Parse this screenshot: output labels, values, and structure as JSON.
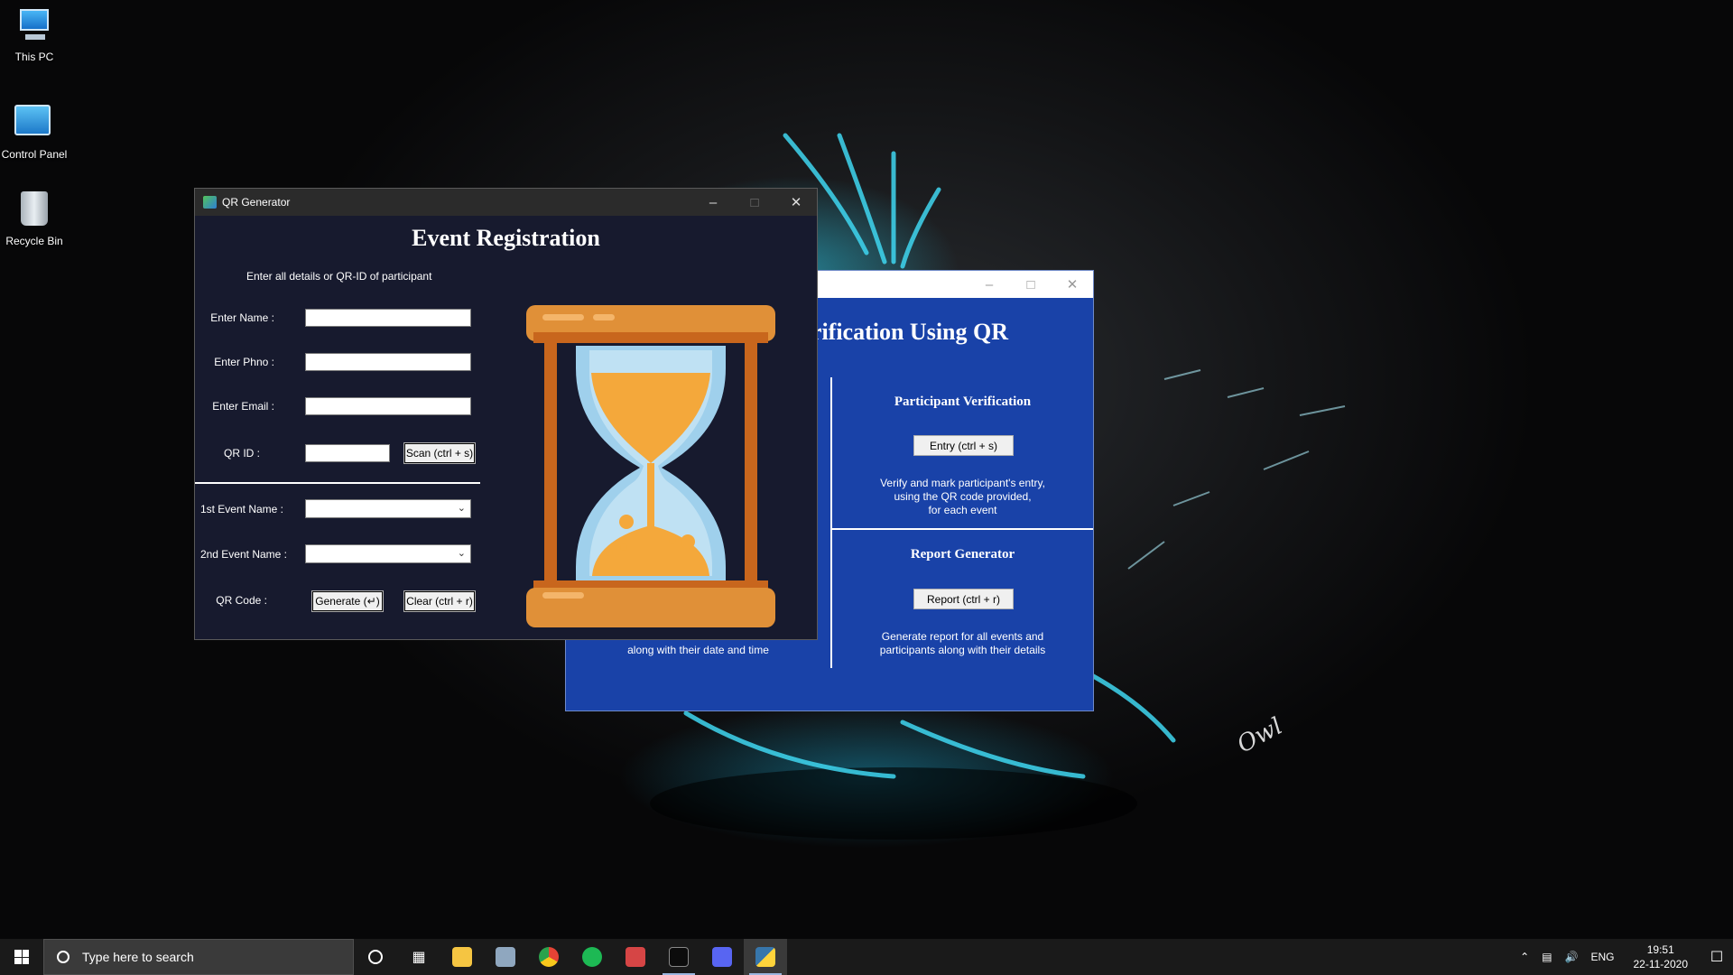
{
  "desktop": {
    "icons": [
      {
        "label": "This PC",
        "icon": "computer-icon"
      },
      {
        "label": "Control Panel",
        "icon": "control-panel-icon"
      },
      {
        "label": "Recycle Bin",
        "icon": "recycle-bin-icon"
      }
    ]
  },
  "back_window": {
    "title_partial": "Verification Using QR",
    "participant_panel": {
      "title": "Participant Verification",
      "button": "Entry (ctrl + s)",
      "description_lines": [
        "Verify and mark participant's entry,",
        "using the QR code provided,",
        "for each event"
      ]
    },
    "report_panel": {
      "title": "Report Generator",
      "button": "Report (ctrl + r)",
      "description_lines": [
        "Generate report for all events and",
        "participants along with their details"
      ]
    },
    "left_panel_visible_text": "along with their date and time"
  },
  "front_window": {
    "title": "QR Generator",
    "heading": "Event Registration",
    "subheading": "Enter all details or QR-ID of participant",
    "form": {
      "name_label": "Enter Name :",
      "name_value": "",
      "phno_label": "Enter Phno :",
      "phno_value": "",
      "email_label": "Enter Email :",
      "email_value": "",
      "qrid_label": "QR ID :",
      "qrid_value": "",
      "scan_button": "Scan (ctrl + s)",
      "event1_label": "1st Event Name :",
      "event1_value": "",
      "event2_label": "2nd Event Name :",
      "event2_value": "",
      "qrcode_label": "QR Code :",
      "generate_button": "Generate (↵)",
      "clear_button": "Clear (ctrl + r)"
    },
    "image": "hourglass-illustration"
  },
  "taskbar": {
    "search_placeholder": "Type here to search",
    "apps": [
      "cortana-icon",
      "task-view-icon",
      "file-explorer-icon",
      "app-icon",
      "chrome-icon",
      "app-icon-2",
      "app-icon-3",
      "terminal-icon",
      "discord-icon",
      "python-icon"
    ],
    "tray": {
      "language": "ENG",
      "time": "19:51",
      "date": "22-11-2020"
    }
  }
}
